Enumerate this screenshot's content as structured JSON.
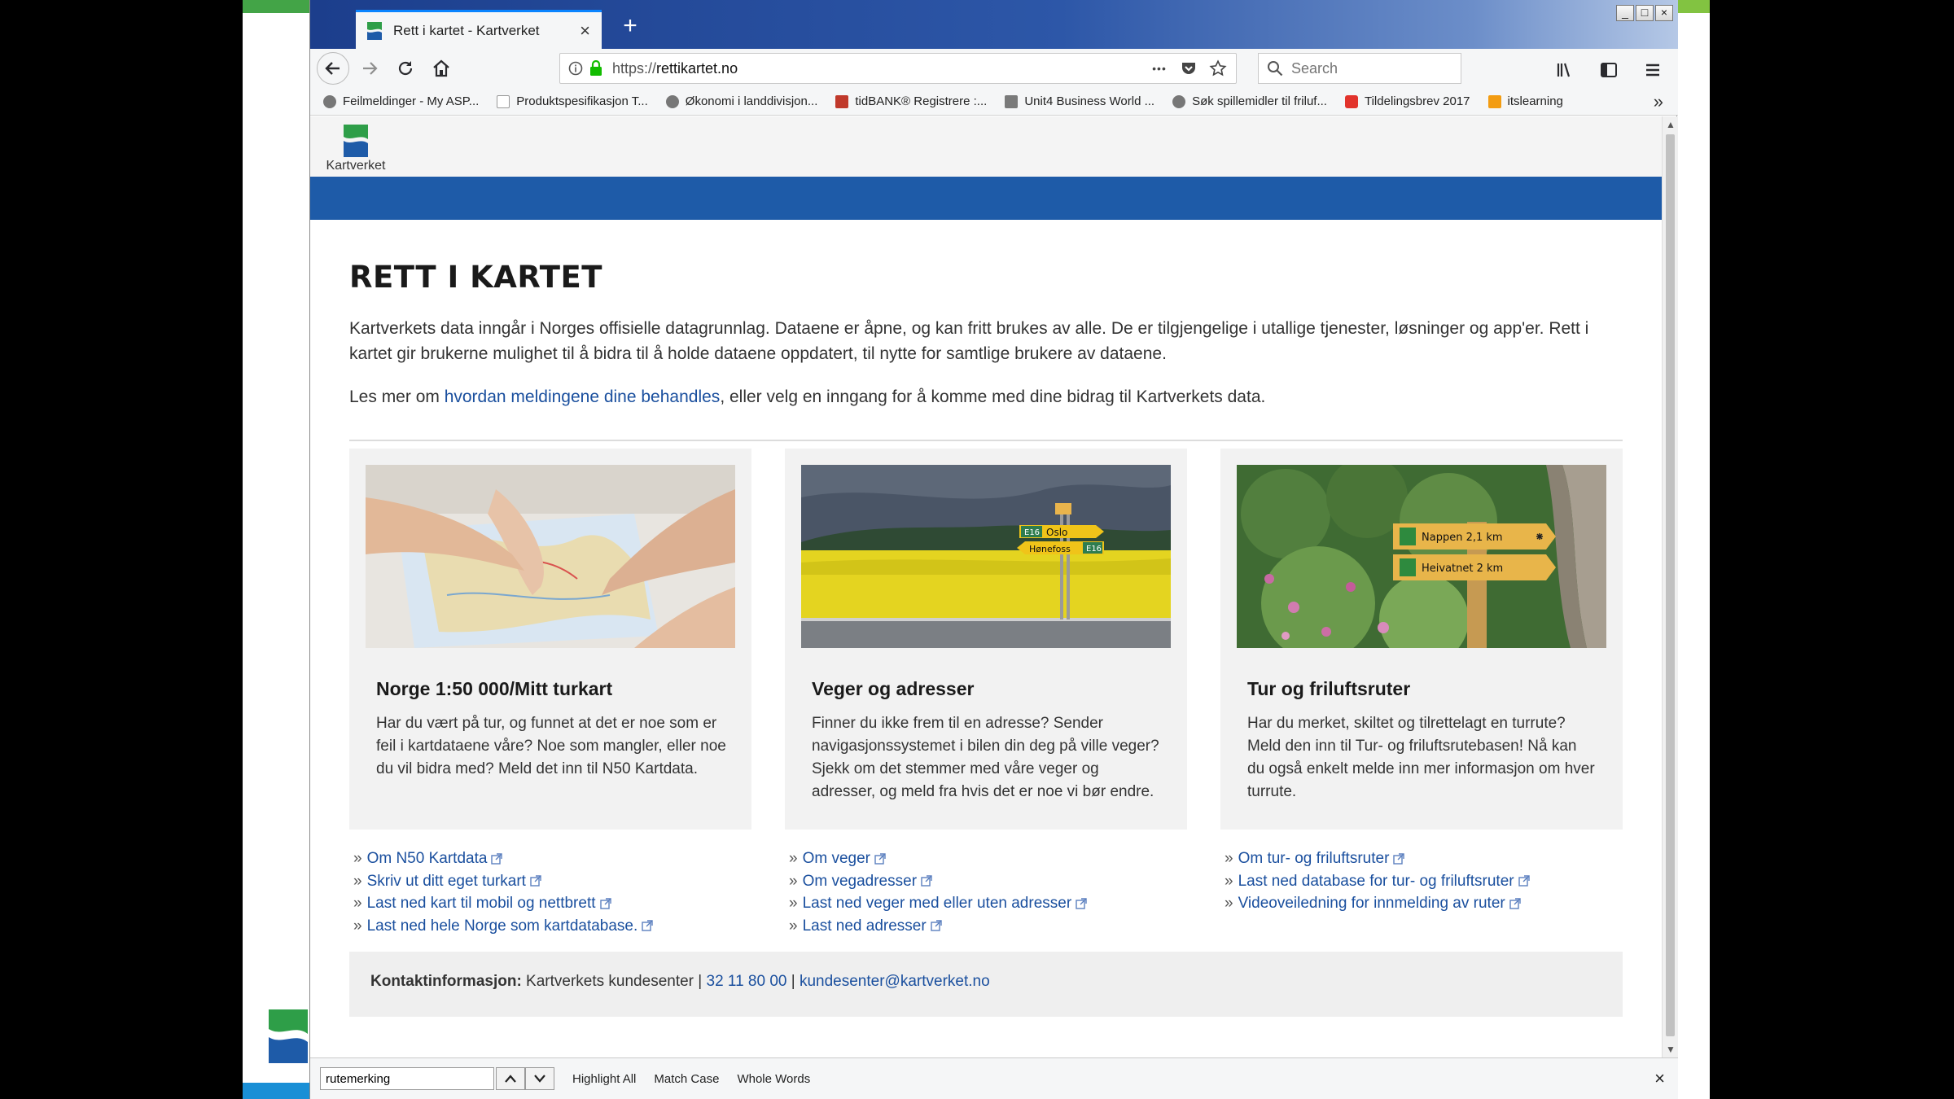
{
  "browser": {
    "tab_title": "Rett i kartet - Kartverket",
    "new_tab": "+",
    "close_tab": "×",
    "window_controls": [
      "_",
      "□",
      "×"
    ],
    "url_prefix": "https://",
    "url_host": "rettikartet.no",
    "url_more": "•••",
    "search_placeholder": "Search",
    "bookmarks_more": "»",
    "bookmarks": [
      "Feilmeldinger - My ASP...",
      "Produktspesifikasjon T...",
      "Økonomi i landdivisjon...",
      "tidBANK® Registrere :...",
      "Unit4 Business World ...",
      "Søk spillemidler til friluf...",
      "Tildelingsbrev 2017",
      "itslearning"
    ]
  },
  "site": {
    "logo_text": "Kartverket",
    "page_title": "RETT I KARTET",
    "intro": "Kartverkets data inngår i Norges offisielle datagrunnlag. Dataene er åpne, og kan fritt brukes av alle. De er tilgjengelige i utallige tjenester, løsninger og app'er. Rett i kartet gir brukerne mulighet til å bidra til å holde dataene oppdatert, til nytte for samtlige brukere av dataene.",
    "intro2_before": "Les mer om ",
    "intro2_link": "hvordan meldingene dine behandles",
    "intro2_after": ", eller velg en inngang for å komme med dine bidrag til Kartverkets data.",
    "cards": [
      {
        "title": "Norge 1:50 000/Mitt turkart",
        "text": "Har du vært på tur, og funnet at det er noe som er feil i kartdataene våre? Noe som mangler, eller noe du vil bidra med? Meld det inn til N50 Kartdata."
      },
      {
        "title": "Veger og adresser",
        "text": "Finner du ikke frem til en adresse? Sender navigasjonssystemet i bilen din deg på ville veger? Sjekk om det stemmer med våre veger og adresser, og meld fra hvis det er noe vi bør endre."
      },
      {
        "title": "Tur og friluftsruter",
        "text": "Har du merket, skiltet og tilrettelagt en turrute? Meld den inn til Tur- og friluftsrutebasen! Nå kan du også enkelt melde inn mer informasjon om hver turrute."
      }
    ],
    "sign_road": {
      "oslo": "Oslo",
      "honefoss": "Hønefoss",
      "e16a": "E16",
      "e16b": "E16"
    },
    "sign_trail": {
      "line1": "Nappen 2,1 km",
      "line2": "Heivatnet 2 km"
    },
    "links": [
      [
        "Om N50 Kartdata",
        "Skriv ut ditt eget turkart",
        "Last ned kart til mobil og nettbrett",
        "Last ned hele Norge som kartdatabase."
      ],
      [
        "Om veger",
        "Om vegadresser",
        "Last ned veger med eller uten adresser",
        "Last ned adresser"
      ],
      [
        "Om tur- og friluftsruter",
        "Last ned database for tur- og friluftsruter",
        "Videoveiledning for innmelding av ruter"
      ]
    ],
    "link_marker": "»",
    "contact": {
      "label": "Kontaktinformasjon:",
      "org": " Kartverkets kundesenter | ",
      "phone": "32 11 80 00",
      "sep": " | ",
      "email": "kundesenter@kartverket.no"
    }
  },
  "findbar": {
    "value": "rutemerking",
    "highlight_all": "Highlight All",
    "match_case": "Match Case",
    "whole_words": "Whole Words",
    "close": "×"
  },
  "colors": {
    "tab_accent": "#0a84ff",
    "site_blue": "#1e5ba8",
    "link": "#1a4f9e",
    "logo_green": "#2e9e48",
    "logo_blue": "#1e5ba8"
  }
}
